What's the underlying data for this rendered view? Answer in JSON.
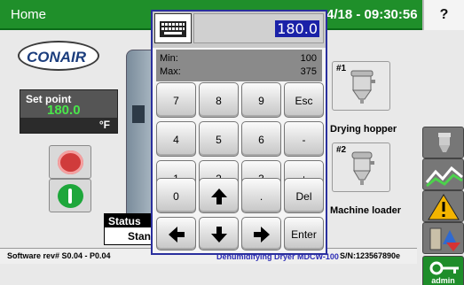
{
  "header": {
    "title": "Home",
    "datetime": "4/18 - 09:30:56",
    "help_label": "?"
  },
  "logo": {
    "text": "CONAIR"
  },
  "setpoint": {
    "label": "Set point",
    "value": "180.0",
    "unit": "°F"
  },
  "status": {
    "title": "Status",
    "value": "Stand"
  },
  "footer": {
    "software": "Software rev# S0.04 - P0.04",
    "product": "Dehumidifying Dryer MDCW-100",
    "serial": "S/N:123567890e"
  },
  "hoppers": [
    {
      "number": "#1",
      "label": "Drying hopper"
    },
    {
      "number": "#2",
      "label": "Machine loader"
    }
  ],
  "toolbar": {
    "admin_label": "admin"
  },
  "keypad": {
    "value": "180.0",
    "min_label": "Min:",
    "min_value": "100",
    "max_label": "Max:",
    "max_value": "375",
    "keys": {
      "k7": "7",
      "k8": "8",
      "k9": "9",
      "esc": "Esc",
      "k4": "4",
      "k5": "5",
      "k6": "6",
      "minus": "-",
      "k1": "1",
      "k2": "2",
      "k3": "3",
      "plus": "+",
      "k0": "0",
      "dot": ".",
      "del": "Del",
      "enter": "Enter"
    }
  },
  "colors": {
    "header_green": "#1f8f2a",
    "setpoint_value": "#49e64a",
    "keypad_border": "#2a2f9e",
    "value_highlight": "#1a22a8"
  }
}
